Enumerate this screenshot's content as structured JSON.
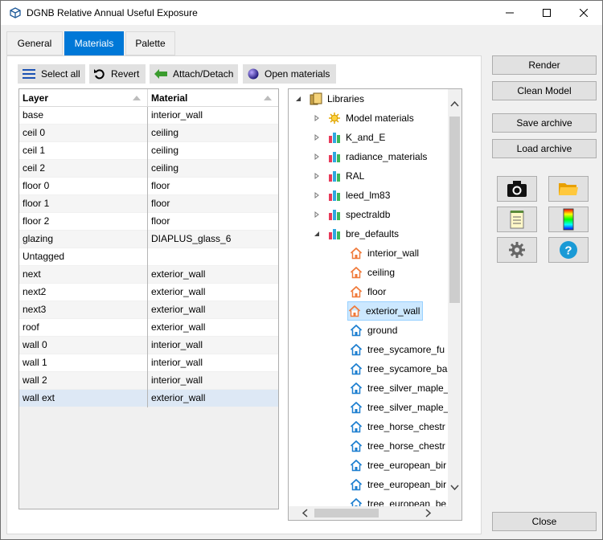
{
  "window": {
    "title": "DGNB Relative Annual Useful Exposure",
    "icons": [
      "app-icon",
      "minimize-icon",
      "maximize-icon",
      "close-icon"
    ]
  },
  "tabs": [
    {
      "label": "General",
      "active": false
    },
    {
      "label": "Materials",
      "active": true
    },
    {
      "label": "Palette",
      "active": false
    }
  ],
  "toolbar": {
    "select_all": "Select all",
    "revert": "Revert",
    "attach_detach": "Attach/Detach",
    "open_materials": "Open materials"
  },
  "grid": {
    "columns": [
      "Layer",
      "Material"
    ],
    "rows": [
      {
        "layer": "base",
        "material": "interior_wall"
      },
      {
        "layer": "ceil 0",
        "material": "ceiling"
      },
      {
        "layer": "ceil 1",
        "material": "ceiling"
      },
      {
        "layer": "ceil 2",
        "material": "ceiling"
      },
      {
        "layer": "floor 0",
        "material": "floor"
      },
      {
        "layer": "floor 1",
        "material": "floor"
      },
      {
        "layer": "floor 2",
        "material": "floor"
      },
      {
        "layer": "glazing",
        "material": "DIAPLUS_glass_6"
      },
      {
        "layer": "Untagged",
        "material": ""
      },
      {
        "layer": "next",
        "material": "exterior_wall"
      },
      {
        "layer": "next2",
        "material": "exterior_wall"
      },
      {
        "layer": "next3",
        "material": "exterior_wall"
      },
      {
        "layer": "roof",
        "material": "exterior_wall"
      },
      {
        "layer": "wall 0",
        "material": "interior_wall"
      },
      {
        "layer": "wall 1",
        "material": "interior_wall"
      },
      {
        "layer": "wall 2",
        "material": "interior_wall"
      },
      {
        "layer": "wall ext",
        "material": "exterior_wall"
      }
    ],
    "selected_row": 16
  },
  "tree": {
    "root": "Libraries",
    "libraries": [
      "Model materials",
      "K_and_E",
      "radiance_materials",
      "RAL",
      "leed_lm83",
      "spectraldb",
      "bre_defaults"
    ],
    "bre_items": [
      "interior_wall",
      "ceiling",
      "floor",
      "exterior_wall",
      "ground",
      "tree_sycamore_fu",
      "tree_sycamore_ba",
      "tree_silver_maple_",
      "tree_silver_maple_",
      "tree_horse_chestr",
      "tree_horse_chestr",
      "tree_european_bir",
      "tree_european_bir",
      "tree_european_be"
    ],
    "selected_item": "exterior_wall"
  },
  "right": {
    "render": "Render",
    "clean_model": "Clean Model",
    "save_archive": "Save archive",
    "load_archive": "Load archive",
    "close": "Close",
    "icon_buttons": [
      "camera-icon",
      "folder-icon",
      "notepad-icon",
      "palette-icon",
      "settings-icon",
      "help-icon"
    ]
  },
  "colors": {
    "accent": "#0078d7",
    "selection": "#cce8ff",
    "row_selected": "#dde8f5"
  }
}
